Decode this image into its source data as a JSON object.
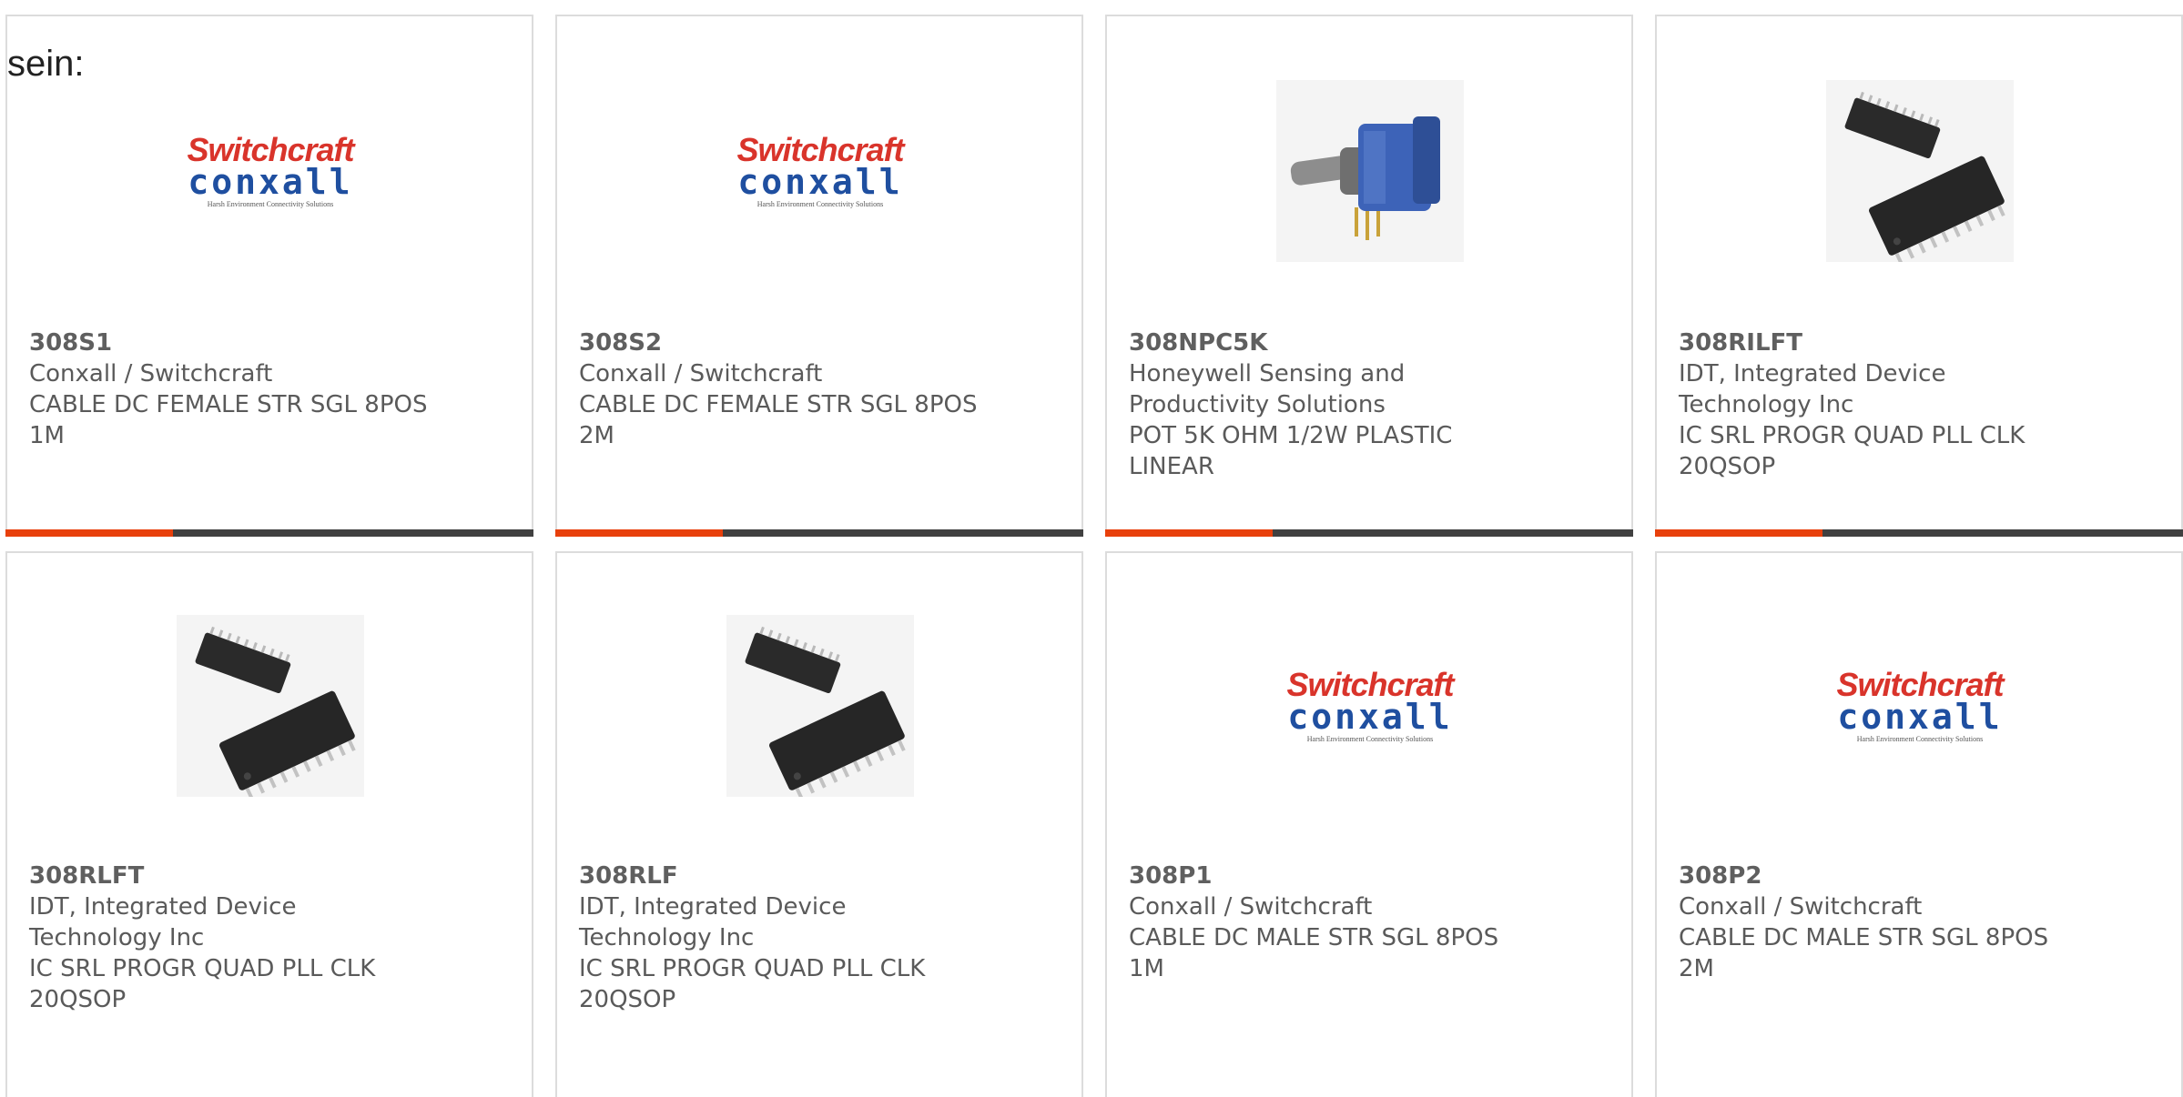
{
  "page": {
    "lead_text": "sein:"
  },
  "colors": {
    "accent": "#e8400c",
    "bar": "#404040",
    "card_border": "#dcdcdc",
    "text": "#5a5a5a"
  },
  "logo": {
    "brand_top": "Switchcraft",
    "brand_bottom": "conxall",
    "tagline": "Harsh Environment Connectivity Solutions"
  },
  "products": [
    {
      "part": "308S1",
      "maker": "Conxall / Switchcraft",
      "desc": "CABLE DC FEMALE STR SGL 8POS 1M",
      "image": "switchcraft-conxall-logo"
    },
    {
      "part": "308S2",
      "maker": "Conxall / Switchcraft",
      "desc": "CABLE DC FEMALE STR SGL 8POS 2M",
      "image": "switchcraft-conxall-logo"
    },
    {
      "part": "308NPC5K",
      "maker": "Honeywell Sensing and Productivity Solutions",
      "desc": "POT 5K OHM 1/2W PLASTIC LINEAR",
      "image": "potentiometer-photo"
    },
    {
      "part": "308RILFT",
      "maker": "IDT, Integrated Device Technology Inc",
      "desc": "IC SRL PROGR QUAD PLL CLK 20QSOP",
      "image": "qsop-chip-photo"
    },
    {
      "part": "308RLFT",
      "maker": "IDT, Integrated Device Technology Inc",
      "desc": "IC SRL PROGR QUAD PLL CLK 20QSOP",
      "image": "qsop-chip-photo"
    },
    {
      "part": "308RLF",
      "maker": "IDT, Integrated Device Technology Inc",
      "desc": "IC SRL PROGR QUAD PLL CLK 20QSOP",
      "image": "qsop-chip-photo"
    },
    {
      "part": "308P1",
      "maker": "Conxall / Switchcraft",
      "desc": "CABLE DC MALE STR SGL 8POS 1M",
      "image": "switchcraft-conxall-logo"
    },
    {
      "part": "308P2",
      "maker": "Conxall / Switchcraft",
      "desc": "CABLE DC MALE STR SGL 8POS 2M",
      "image": "switchcraft-conxall-logo"
    }
  ]
}
